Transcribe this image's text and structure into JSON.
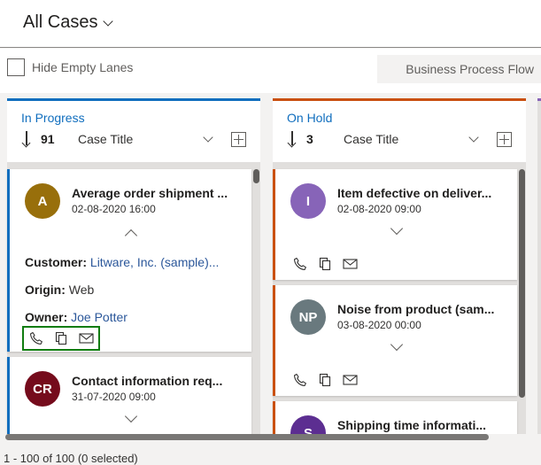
{
  "header": {
    "view_title": "All Cases"
  },
  "toolbar": {
    "hide_empty_label": "Hide Empty Lanes",
    "bpf_label": "Business Process Flow"
  },
  "lanes": [
    {
      "name": "In Progress",
      "count": "91",
      "sort_field": "Case Title",
      "color": "#106ebe",
      "cards": [
        {
          "initials": "A",
          "avatar_color": "#986f0b",
          "title": "Average order shipment ...",
          "date": "02-08-2020 16:00",
          "fields": [
            {
              "label": "Customer:",
              "value": "Litware, Inc. (sample)..."
            },
            {
              "label": "Origin:",
              "value": "Web"
            },
            {
              "label": "Owner:",
              "value": "Joe Potter"
            }
          ]
        },
        {
          "initials": "CR",
          "avatar_color": "#750b1c",
          "title": "Contact information req...",
          "date": "31-07-2020 09:00"
        }
      ]
    },
    {
      "name": "On Hold",
      "count": "3",
      "sort_field": "Case Title",
      "color": "#ca5010",
      "cards": [
        {
          "initials": "I",
          "avatar_color": "#8764b8",
          "title": "Item defective on deliver...",
          "date": "02-08-2020 09:00"
        },
        {
          "initials": "NP",
          "avatar_color": "#69797e",
          "title": "Noise from product (sam...",
          "date": "03-08-2020 00:00"
        },
        {
          "initials": "S",
          "avatar_color": "#5c2e91",
          "title": "Shipping time informati..."
        }
      ]
    }
  ],
  "footer": {
    "status": "1 - 100 of 100 (0 selected)"
  },
  "icons": [
    "chevron-down-icon",
    "sort-arrow-icon",
    "add-icon",
    "phone-icon",
    "document-icon",
    "email-icon",
    "chevron-up-icon"
  ]
}
